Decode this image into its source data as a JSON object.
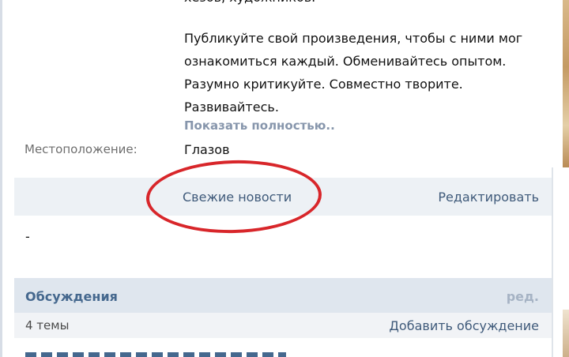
{
  "description": {
    "cut_top": "хезов, художников.",
    "lines": [
      "Публикуйте свой произведения, чтобы с ними мог",
      "ознакомиться каждый. Обменивайтесь опытом.",
      "Разумно критикуйте. Совместно творите.",
      "Развивайтесь."
    ],
    "show_more": "Показать полностью.."
  },
  "location": {
    "label": "Местоположение:",
    "value": "Глазов"
  },
  "news": {
    "link": "Свежие новости",
    "edit": "Редактировать",
    "content": "-"
  },
  "discussions": {
    "title": "Обсуждения",
    "edit": "ред.",
    "count": "4 темы",
    "add": "Добавить обсуждение"
  },
  "annotation": {
    "color": "#d8262a"
  }
}
